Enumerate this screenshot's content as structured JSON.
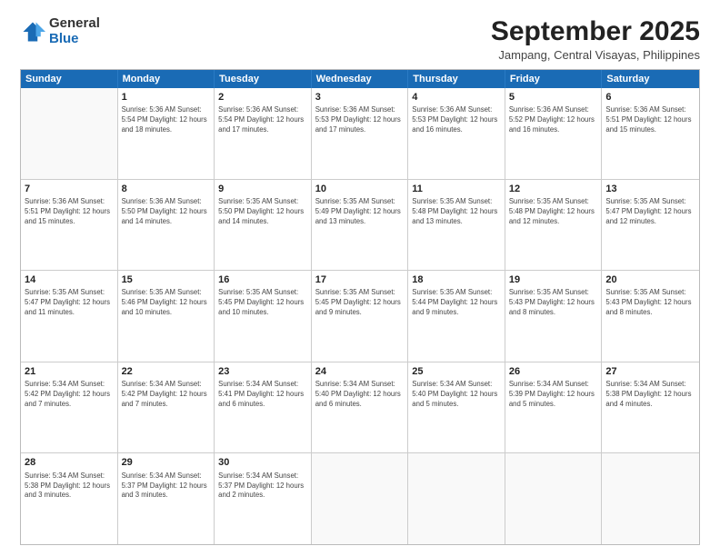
{
  "header": {
    "logo": {
      "general": "General",
      "blue": "Blue"
    },
    "title": "September 2025",
    "subtitle": "Jampang, Central Visayas, Philippines"
  },
  "calendar": {
    "days_of_week": [
      "Sunday",
      "Monday",
      "Tuesday",
      "Wednesday",
      "Thursday",
      "Friday",
      "Saturday"
    ],
    "weeks": [
      [
        {
          "day": "",
          "info": ""
        },
        {
          "day": "1",
          "info": "Sunrise: 5:36 AM\nSunset: 5:54 PM\nDaylight: 12 hours\nand 18 minutes."
        },
        {
          "day": "2",
          "info": "Sunrise: 5:36 AM\nSunset: 5:54 PM\nDaylight: 12 hours\nand 17 minutes."
        },
        {
          "day": "3",
          "info": "Sunrise: 5:36 AM\nSunset: 5:53 PM\nDaylight: 12 hours\nand 17 minutes."
        },
        {
          "day": "4",
          "info": "Sunrise: 5:36 AM\nSunset: 5:53 PM\nDaylight: 12 hours\nand 16 minutes."
        },
        {
          "day": "5",
          "info": "Sunrise: 5:36 AM\nSunset: 5:52 PM\nDaylight: 12 hours\nand 16 minutes."
        },
        {
          "day": "6",
          "info": "Sunrise: 5:36 AM\nSunset: 5:51 PM\nDaylight: 12 hours\nand 15 minutes."
        }
      ],
      [
        {
          "day": "7",
          "info": "Sunrise: 5:36 AM\nSunset: 5:51 PM\nDaylight: 12 hours\nand 15 minutes."
        },
        {
          "day": "8",
          "info": "Sunrise: 5:36 AM\nSunset: 5:50 PM\nDaylight: 12 hours\nand 14 minutes."
        },
        {
          "day": "9",
          "info": "Sunrise: 5:35 AM\nSunset: 5:50 PM\nDaylight: 12 hours\nand 14 minutes."
        },
        {
          "day": "10",
          "info": "Sunrise: 5:35 AM\nSunset: 5:49 PM\nDaylight: 12 hours\nand 13 minutes."
        },
        {
          "day": "11",
          "info": "Sunrise: 5:35 AM\nSunset: 5:48 PM\nDaylight: 12 hours\nand 13 minutes."
        },
        {
          "day": "12",
          "info": "Sunrise: 5:35 AM\nSunset: 5:48 PM\nDaylight: 12 hours\nand 12 minutes."
        },
        {
          "day": "13",
          "info": "Sunrise: 5:35 AM\nSunset: 5:47 PM\nDaylight: 12 hours\nand 12 minutes."
        }
      ],
      [
        {
          "day": "14",
          "info": "Sunrise: 5:35 AM\nSunset: 5:47 PM\nDaylight: 12 hours\nand 11 minutes."
        },
        {
          "day": "15",
          "info": "Sunrise: 5:35 AM\nSunset: 5:46 PM\nDaylight: 12 hours\nand 10 minutes."
        },
        {
          "day": "16",
          "info": "Sunrise: 5:35 AM\nSunset: 5:45 PM\nDaylight: 12 hours\nand 10 minutes."
        },
        {
          "day": "17",
          "info": "Sunrise: 5:35 AM\nSunset: 5:45 PM\nDaylight: 12 hours\nand 9 minutes."
        },
        {
          "day": "18",
          "info": "Sunrise: 5:35 AM\nSunset: 5:44 PM\nDaylight: 12 hours\nand 9 minutes."
        },
        {
          "day": "19",
          "info": "Sunrise: 5:35 AM\nSunset: 5:43 PM\nDaylight: 12 hours\nand 8 minutes."
        },
        {
          "day": "20",
          "info": "Sunrise: 5:35 AM\nSunset: 5:43 PM\nDaylight: 12 hours\nand 8 minutes."
        }
      ],
      [
        {
          "day": "21",
          "info": "Sunrise: 5:34 AM\nSunset: 5:42 PM\nDaylight: 12 hours\nand 7 minutes."
        },
        {
          "day": "22",
          "info": "Sunrise: 5:34 AM\nSunset: 5:42 PM\nDaylight: 12 hours\nand 7 minutes."
        },
        {
          "day": "23",
          "info": "Sunrise: 5:34 AM\nSunset: 5:41 PM\nDaylight: 12 hours\nand 6 minutes."
        },
        {
          "day": "24",
          "info": "Sunrise: 5:34 AM\nSunset: 5:40 PM\nDaylight: 12 hours\nand 6 minutes."
        },
        {
          "day": "25",
          "info": "Sunrise: 5:34 AM\nSunset: 5:40 PM\nDaylight: 12 hours\nand 5 minutes."
        },
        {
          "day": "26",
          "info": "Sunrise: 5:34 AM\nSunset: 5:39 PM\nDaylight: 12 hours\nand 5 minutes."
        },
        {
          "day": "27",
          "info": "Sunrise: 5:34 AM\nSunset: 5:38 PM\nDaylight: 12 hours\nand 4 minutes."
        }
      ],
      [
        {
          "day": "28",
          "info": "Sunrise: 5:34 AM\nSunset: 5:38 PM\nDaylight: 12 hours\nand 3 minutes."
        },
        {
          "day": "29",
          "info": "Sunrise: 5:34 AM\nSunset: 5:37 PM\nDaylight: 12 hours\nand 3 minutes."
        },
        {
          "day": "30",
          "info": "Sunrise: 5:34 AM\nSunset: 5:37 PM\nDaylight: 12 hours\nand 2 minutes."
        },
        {
          "day": "",
          "info": ""
        },
        {
          "day": "",
          "info": ""
        },
        {
          "day": "",
          "info": ""
        },
        {
          "day": "",
          "info": ""
        }
      ]
    ]
  }
}
